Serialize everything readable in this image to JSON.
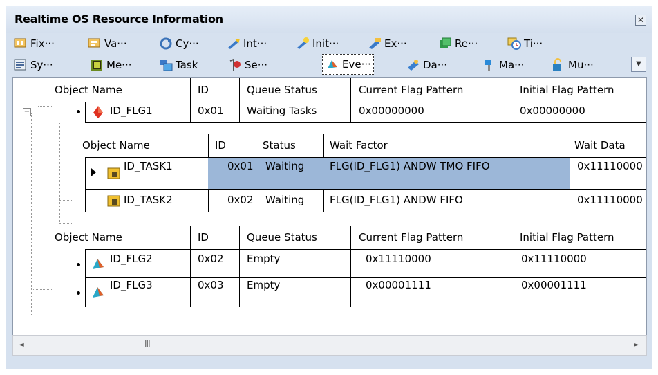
{
  "window": {
    "title": "Realtime OS Resource Information",
    "close_glyph": "✕"
  },
  "toolbar": {
    "row1": [
      {
        "label": "Fix···",
        "icon": "fixed-memory-pool-icon",
        "color": "#e09a2b"
      },
      {
        "label": "Va···",
        "icon": "variable-memory-pool-icon",
        "color": "#e0a630"
      },
      {
        "label": "Cy···",
        "icon": "cyclic-handler-icon",
        "color": "#4f86c8"
      },
      {
        "label": "Int···",
        "icon": "interrupt-handler-icon",
        "color": "#e8b820"
      },
      {
        "label": "Init···",
        "icon": "initialize-routine-icon",
        "color": "#f0c020"
      },
      {
        "label": "Ex···",
        "icon": "exception-icon",
        "color": "#3a80d0"
      },
      {
        "label": "Re···",
        "icon": "ready-queue-icon",
        "color": "#3aa050"
      },
      {
        "label": "Ti···",
        "icon": "timer-queue-icon",
        "color": "#d0a020"
      }
    ],
    "row2": [
      {
        "label": "Sy···",
        "icon": "system-state-icon",
        "color": "#5a8a50"
      },
      {
        "label": "Me···",
        "icon": "memory-icon",
        "color": "#6a8a20"
      },
      {
        "label": "Task",
        "icon": "task-icon",
        "color": "#3a7ac8"
      },
      {
        "label": "Se···",
        "icon": "semaphore-icon",
        "color": "#c03030"
      },
      {
        "label": "Eve···",
        "icon": "eventflag-icon",
        "color": "#30a8c8",
        "active": true
      },
      {
        "label": "Da···",
        "icon": "data-queue-icon",
        "color": "#3a80d0"
      },
      {
        "label": "Ma···",
        "icon": "mailbox-icon",
        "color": "#2a8ad8"
      },
      {
        "label": "Mu···",
        "icon": "mutex-icon",
        "color": "#2a80c0"
      }
    ],
    "overflow_glyph": "▼"
  },
  "flag_header": {
    "object_name": "Object Name",
    "id": "ID",
    "queue_status": "Queue Status",
    "current_flag_pattern": "Current Flag Pattern",
    "initial_flag_pattern": "Initial Flag Pattern"
  },
  "flag1": {
    "name": "ID_FLG1",
    "id": "0x01",
    "queue_status": "Waiting Tasks",
    "current": "0x00000000",
    "initial": "0x00000000",
    "expander": "−"
  },
  "task_header": {
    "object_name": "Object Name",
    "id": "ID",
    "status": "Status",
    "wait_factor": "Wait Factor",
    "wait_data": "Wait Data"
  },
  "tasks": [
    {
      "name": "ID_TASK1",
      "id": "0x01",
      "status": "Waiting",
      "wait_factor": "FLG(ID_FLG1) ANDW TMO FIFO",
      "wait_data": "0x11110000"
    },
    {
      "name": "ID_TASK2",
      "id": "0x02",
      "status": "Waiting",
      "wait_factor": "FLG(ID_FLG1) ANDW FIFO",
      "wait_data": "0x11110000"
    }
  ],
  "flag_header2": {
    "object_name": "Object Name",
    "id": "ID",
    "queue_status": "Queue Status",
    "current_flag_pattern": "Current Flag Pattern",
    "initial_flag_pattern": "Initial Flag Pattern"
  },
  "flags_other": [
    {
      "name": "ID_FLG2",
      "id": "0x02",
      "queue_status": "Empty",
      "current": "0x11110000",
      "initial": "0x11110000"
    },
    {
      "name": "ID_FLG3",
      "id": "0x03",
      "queue_status": "Empty",
      "current": "0x00001111",
      "initial": "0x00001111"
    }
  ],
  "scrollbar": {
    "left_arrow": "◄",
    "right_arrow": "►",
    "grip": "III"
  },
  "colors": {
    "selection": "#9cb7d8",
    "eventflag_red": "#e03020",
    "eventflag_cyan": "#2aa8c8",
    "task_yellow": "#f0c030"
  }
}
